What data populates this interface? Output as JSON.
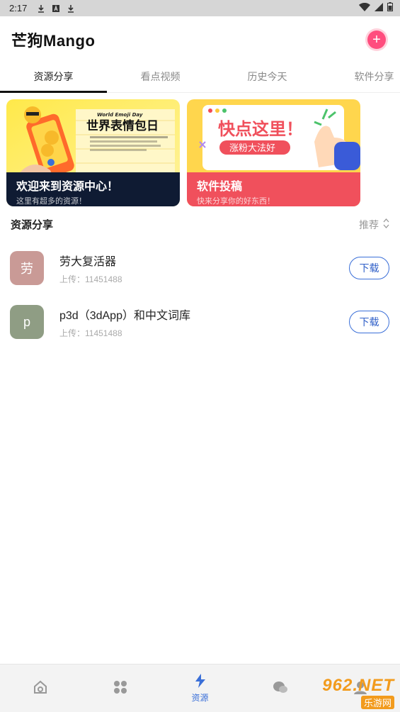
{
  "status": {
    "time": "2:17"
  },
  "header": {
    "title": "芒狗Mango",
    "add_label": "+"
  },
  "tabs": [
    {
      "label": "资源分享"
    },
    {
      "label": "看点视频"
    },
    {
      "label": "历史今天"
    },
    {
      "label": "软件分享"
    }
  ],
  "banners": [
    {
      "title": "欢迎来到资源中心！",
      "subtitle": "这里有超多的资源！",
      "art_heading": "世界表情包日",
      "art_small": "World Emoji Day"
    },
    {
      "title": "软件投稿",
      "subtitle": "快来分享你的好东西！",
      "art_heading": "快点这里！",
      "art_small": "涨粉大法好"
    }
  ],
  "section": {
    "title": "资源分享",
    "sort_label": "推荐"
  },
  "items": [
    {
      "avatar": "劳",
      "avatar_color": "#c99a96",
      "name": "劳大复活器",
      "uploader": "上传：11451488",
      "button": "下载"
    },
    {
      "avatar": "p",
      "avatar_color": "#8f9d84",
      "name": "p3d（3dApp）和中文词库",
      "uploader": "上传：11451488",
      "button": "下载"
    }
  ],
  "nav": [
    {
      "icon": "home-icon",
      "label": ""
    },
    {
      "icon": "apps-icon",
      "label": ""
    },
    {
      "icon": "bolt-icon",
      "label": "资源"
    },
    {
      "icon": "chat-icon",
      "label": ""
    },
    {
      "icon": "profile-icon",
      "label": ""
    }
  ],
  "watermark": {
    "big": "962.NET",
    "small": "乐游网"
  },
  "colors": {
    "accent": "#3a6fd8",
    "add_button": "#ff4d7e"
  }
}
